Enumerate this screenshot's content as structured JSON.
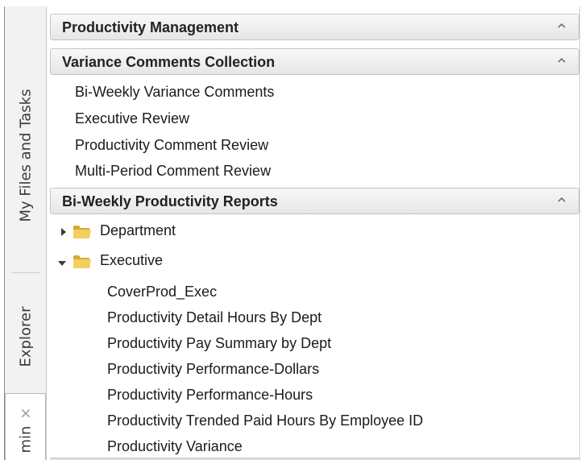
{
  "side_tabs": {
    "my_files": "My Files and Tasks",
    "explorer": "Explorer",
    "admin": "min",
    "admin_close": "×"
  },
  "sections": [
    {
      "title": "Productivity Management",
      "items": []
    },
    {
      "title": "Variance Comments Collection",
      "items": [
        "Bi-Weekly Variance Comments",
        "Executive Review",
        "Productivity Comment Review",
        "Multi-Period Comment Review"
      ]
    },
    {
      "title": "Bi-Weekly Productivity Reports",
      "folders": [
        {
          "label": "Department",
          "expanded": false,
          "items": []
        },
        {
          "label": "Executive",
          "expanded": true,
          "items": [
            "CoverProd_Exec",
            "Productivity Detail Hours By Dept",
            "Productivity Pay Summary by Dept",
            "Productivity Performance-Dollars",
            "Productivity Performance-Hours",
            "Productivity Trended Paid Hours By Employee ID",
            "Productivity Variance"
          ]
        }
      ]
    }
  ],
  "colors": {
    "header_top": "#f8f8f8",
    "header_bottom": "#e6e6e6",
    "folder": "#e8c45a"
  },
  "icons": {
    "collapse": "chevron-up-icon",
    "expanded": "triangle-down-icon",
    "collapsed": "triangle-right-icon",
    "folder": "folder-icon"
  }
}
